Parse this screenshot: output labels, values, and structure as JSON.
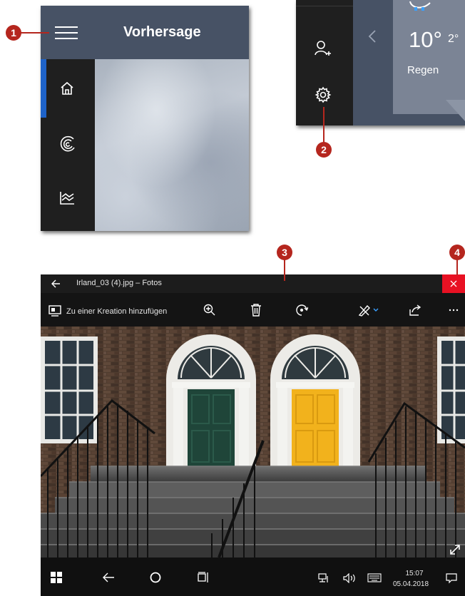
{
  "callouts": [
    "1",
    "2",
    "3",
    "4"
  ],
  "weather": {
    "title": "Vorhersage",
    "temperature": "10°",
    "temperature_second": "2°",
    "condition": "Regen"
  },
  "photos": {
    "window_title": "Irland_03 (4).jpg – Fotos",
    "add_to_creation": "Zu einer Kreation hinzufügen"
  },
  "taskbar": {
    "time": "15:07",
    "date": "05.04.2018"
  },
  "colors": {
    "accent": "#1e63c9",
    "callout": "#b5261e",
    "close": "#e81123",
    "header": "#475265"
  },
  "icons": [
    "hamburger-menu-icon",
    "home-icon",
    "radar-icon",
    "chart-icon",
    "add-user-icon",
    "chevron-left-icon",
    "settings-gear-icon",
    "back-arrow-icon",
    "close-icon",
    "slideshow-icon",
    "zoom-in-icon",
    "delete-icon",
    "rotate-icon",
    "edit-icon",
    "share-icon",
    "more-icon",
    "fullscreen-icon",
    "windows-start-icon",
    "circle-icon",
    "task-view-icon",
    "network-icon",
    "volume-icon",
    "keyboard-icon",
    "notification-icon"
  ]
}
